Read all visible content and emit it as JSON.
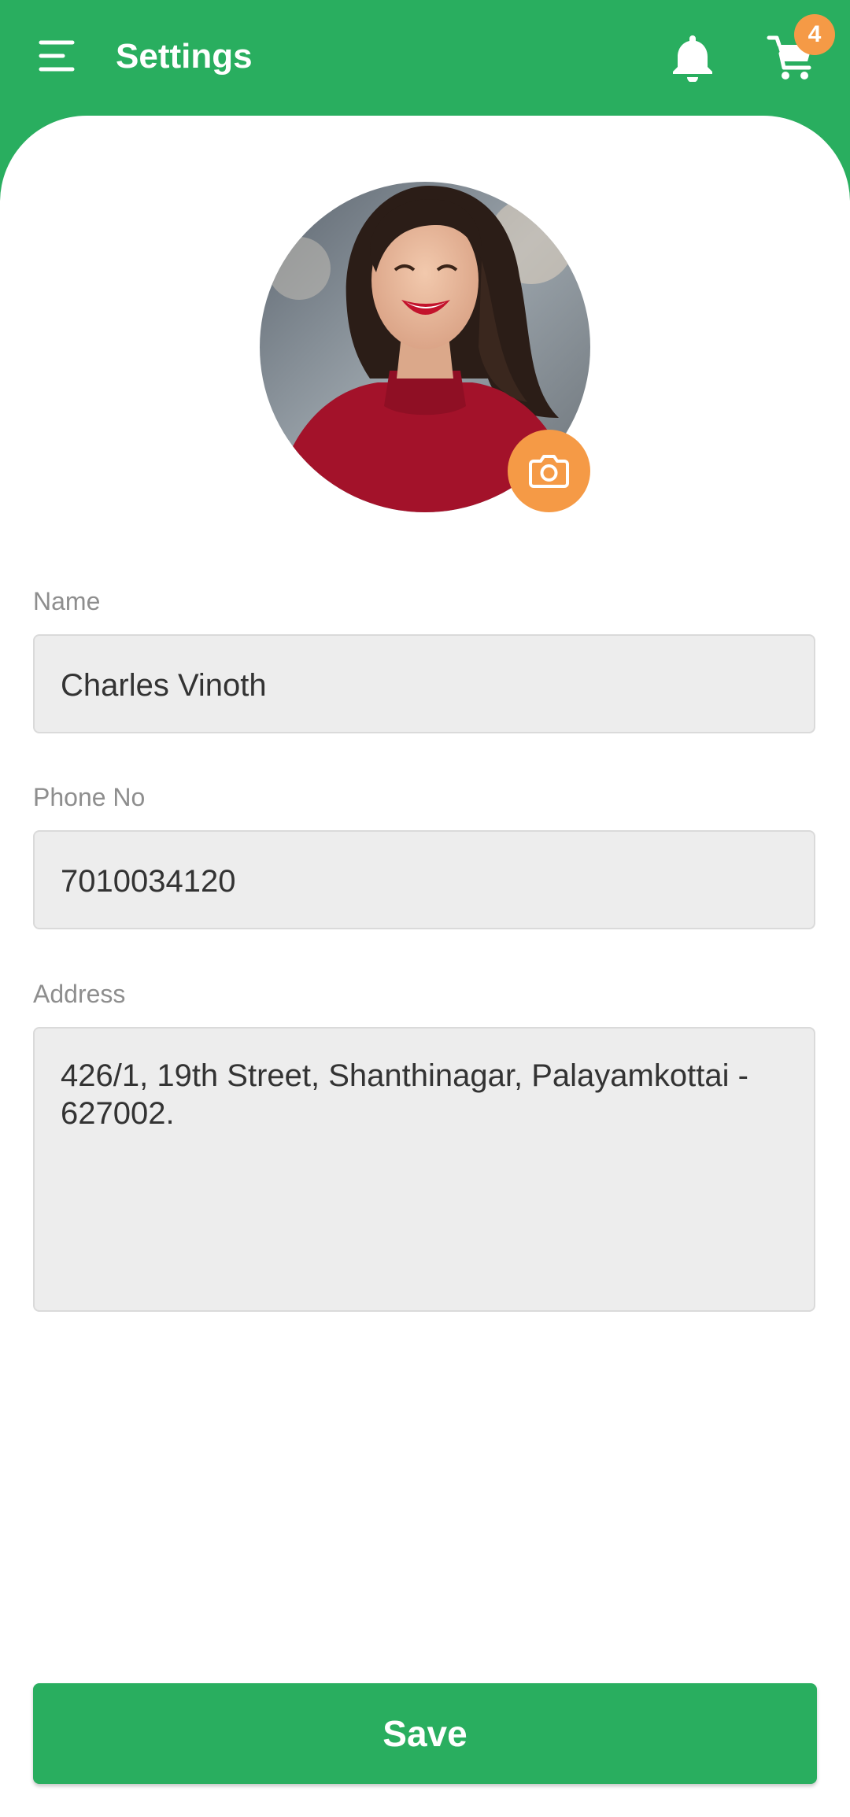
{
  "app_bar": {
    "title": "Settings",
    "menu_icon": "menu-icon",
    "notification_icon": "bell-icon",
    "cart_icon": "cart-icon",
    "cart_count": "4"
  },
  "profile": {
    "photo": "profile-photo",
    "camera_icon": "camera-icon"
  },
  "form": {
    "name_label": "Name",
    "name_value": "Charles Vinoth",
    "phone_label": "Phone No",
    "phone_value": "7010034120",
    "address_label": "Address",
    "address_value": "426/1, 19th Street, Shanthinagar, Palayamkottai - 627002."
  },
  "actions": {
    "save_label": "Save"
  },
  "colors": {
    "primary": "#29ae5f",
    "accent": "#f59a46",
    "field_bg": "#ededed",
    "label": "#8e8e8e",
    "text": "#333333"
  }
}
